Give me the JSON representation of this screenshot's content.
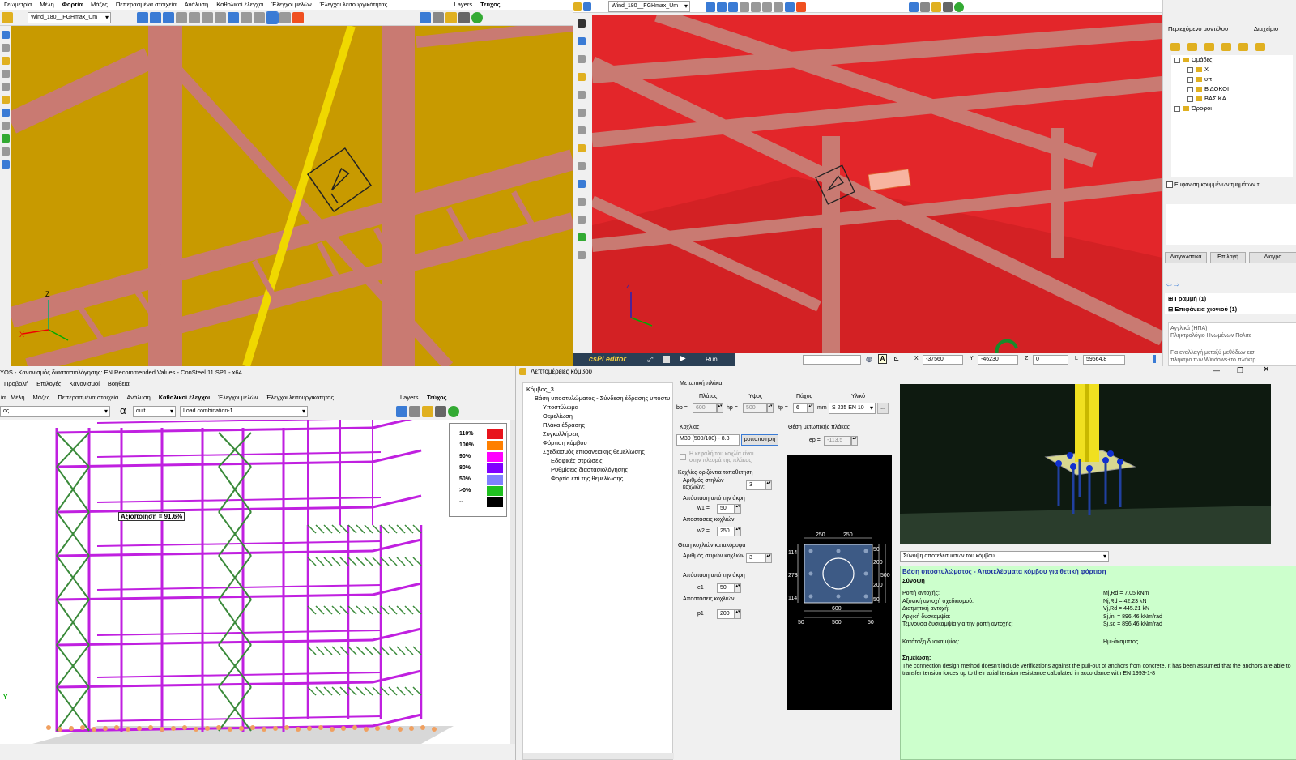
{
  "q1": {
    "menu": [
      "Γεωμετρία",
      "Μέλη",
      "Φορτία",
      "Μάζες",
      "Πεπερασμένα στοιχεία",
      "Ανάλυση",
      "Καθολικοί έλεγχοι",
      "Έλεγχοι μελών",
      "Έλεγχοι λειτουργικότητας"
    ],
    "menu_active": "Φορτία",
    "tabs": [
      "Layers",
      "Τεύχος"
    ],
    "combo": "Wind_180__FGHmax_Um",
    "axis_z": "Z",
    "axis_x": "X"
  },
  "q2": {
    "combo": "Wind_180__FGHmax_Um",
    "axis_z": "Z",
    "cspi": "csPI editor",
    "run": "Run",
    "coords": {
      "x_label": "X",
      "x": "-37560",
      "y_label": "Y",
      "y": "-46230",
      "z_label": "Z",
      "z": "0",
      "l_label": "L",
      "l": "59564,8"
    }
  },
  "panel": {
    "tabs": [
      "Περιεχόμενο μοντέλου",
      "Διαχείρισ"
    ],
    "tree": [
      {
        "label": "Ομάδες",
        "indent": 0
      },
      {
        "label": "X",
        "indent": 1
      },
      {
        "label": "υπ",
        "indent": 1
      },
      {
        "label": "Β ΔΟΚΟΙ",
        "indent": 1
      },
      {
        "label": "ΒΑΣΙΚΑ",
        "indent": 1
      },
      {
        "label": "Όροφοι",
        "indent": 0
      }
    ],
    "show_hidden": "Εμφάνιση κρυμμένων τμημάτων τ",
    "buttons": [
      "Διαγνωστικά",
      "Επιλογή",
      "Διαγρα"
    ],
    "list": [
      {
        "label": "Γραμμή (1)"
      },
      {
        "label": "Επιφάνεια χιονιού (1)"
      }
    ],
    "lang": "Αγγλικά (ΗΠΑ)",
    "lang2": "Πληκτρολόγιο Ηνωμένων Πολιτε",
    "hint1": "Για εναλλαγή μεταξύ μεθόδων εισ",
    "hint2": "πλήκτρο των Windows+το πλήκτρ"
  },
  "q3": {
    "title": "YOS - Κανονισμός διαστασιολόγησης: EN Recommended Values - ConSteel 11 SP1 - x64",
    "menu1": [
      "Προβολή",
      "Επιλογές",
      "Κανονισμοί",
      "Βοήθεια"
    ],
    "menu2": [
      "Μέλη",
      "Μάζες",
      "Πεπερασμένα στοιχεία",
      "Ανάλυση",
      "Καθολικοί έλεγχοι",
      "Έλεγχοι μελών",
      "Έλεγχοι λειτουργικότητας"
    ],
    "menu2_active": "Καθολικοί έλεγχοι",
    "tabs": [
      "Layers",
      "Τεύχος"
    ],
    "combo_left": "ος",
    "alpha": "α",
    "alpha_combo": "αult",
    "load_combo": "Load combination-1",
    "utilization": "Αξιοποίηση = 91.6%",
    "legend": [
      {
        "label": "110%",
        "color": "#e8141c"
      },
      {
        "label": "100%",
        "color": "#ff7f00"
      },
      {
        "label": "90%",
        "color": "#ff00ff"
      },
      {
        "label": "80%",
        "color": "#8000ff"
      },
      {
        "label": "50%",
        "color": "#8080ff"
      },
      {
        "label": ">0%",
        "color": "#20c020"
      },
      {
        "label": "--",
        "color": "#000000"
      }
    ],
    "axis_y": "Y"
  },
  "dialog": {
    "title": "Λεπτομέρειες κόμβου",
    "tree": [
      {
        "label": "Κόμβος_3",
        "indent": 0
      },
      {
        "label": "Βάση υποστυλώματος - Σύνδεση έδρασης υποστυ",
        "indent": 1
      },
      {
        "label": "Υποστύλωμα",
        "indent": 2
      },
      {
        "label": "Θεμελίωση",
        "indent": 2
      },
      {
        "label": "Πλάκα έδρασης",
        "indent": 2
      },
      {
        "label": "Συγκολλήσεις",
        "indent": 2
      },
      {
        "label": "Φόρτιση κόμβου",
        "indent": 2
      },
      {
        "label": "Σχεδιασμός επιφανειακής θεμελίωσης",
        "indent": 2
      },
      {
        "label": "Εδαφικές στρώσεις",
        "indent": 3
      },
      {
        "label": "Ρυθμίσεις διαστασιολόγησης",
        "indent": 3
      },
      {
        "label": "Φορτία επί της θεμελίωσης",
        "indent": 3
      }
    ],
    "plate": {
      "title": "Μετωπική πλάκα",
      "h_width": "Πλάτος",
      "h_height": "Ύψος",
      "h_thick": "Πάχος",
      "h_mat": "Υλικό",
      "bp_label": "bp =",
      "bp": "600",
      "hp_label": "hp =",
      "hp": "500",
      "tp_label": "tp =",
      "tp": "6",
      "mm": "mm",
      "mat": "S 235 EN 10"
    },
    "bolts": {
      "title": "Κοχλίας",
      "bolt": "M30 (500/100) - 8.8",
      "btn": "ροποποίηση",
      "pos_title": "Θέση μετωπικής πλάκας",
      "ep_label": "ep =",
      "ep": "-113.5",
      "note1": "Η κεφαλή του κοχλία είναι",
      "note2": "στην πλευρά της πλάκας",
      "horiz": "Κοχλίες-οριζόντια τοποθέτηση",
      "ncol_label": "Αριθμός στηλών",
      "ncol_label2": "κοχλιών:",
      "ncol": "3",
      "edge_label": "Απόσταση από την άκρη",
      "w1_label": "w1 =",
      "w1": "50",
      "spacing_label": "Αποστάσεις κοχλιών",
      "w2_label": "w2 =",
      "w2": "250",
      "vert": "Θέση κοχλιών κατακόρυφα",
      "nrow_label": "Αριθμός σειρών κοχλιών",
      "nrow": "3",
      "edge2_label": "Απόσταση από την άκρη",
      "e1_label": "e1",
      "e1": "50",
      "spacing2_label": "Αποστάσεις κοχλιών",
      "p1_label": "p1",
      "p1": "200"
    },
    "drawing": {
      "top": [
        "250",
        "250"
      ],
      "left": [
        "114",
        "273",
        "114"
      ],
      "right_in": [
        "50",
        "200",
        "200",
        "50"
      ],
      "right_out": "500",
      "bottom1": "600",
      "bottom2": [
        "50",
        "500",
        "50"
      ]
    },
    "results": {
      "combo": "Σύνοψη αποτελεσμάτων του κόμβου",
      "title": "Βάση υποστυλώματος - Αποτελέσματα κόμβου για θετική φόρτιση",
      "subtitle": "Σύνοψη",
      "rows": [
        {
          "label": "Ροπή αντοχής:",
          "value": "Mj,Rd = 7.05 kNm"
        },
        {
          "label": "Αξονική αντοχή σχεδιασμού:",
          "value": "Nj,Rd = 42.23 kN"
        },
        {
          "label": "Διατμητική αντοχή:",
          "value": "Vj,Rd = 445.21 kN"
        },
        {
          "label": "Αρχική δυσκαμψία:",
          "value": "Sj,ini = 896.46 kNm/rad"
        },
        {
          "label": "Τέμνουσα δυσκαμψία για την ροπή αντοχής:",
          "value": "Sj,sc = 896.46 kNm/rad"
        }
      ],
      "class_label": "Κατάταξη δυσκαμψίας:",
      "class_value": "Ημι-άκαμπτος",
      "note_title": "Σημείωση:",
      "note": "The connection design method doesn't include verifications against the pull-out of anchors from concrete. It has been assumed that the anchors are able to transfer tension forces up to their axial tension resistance calculated in accordance with EN 1993-1-8"
    }
  }
}
